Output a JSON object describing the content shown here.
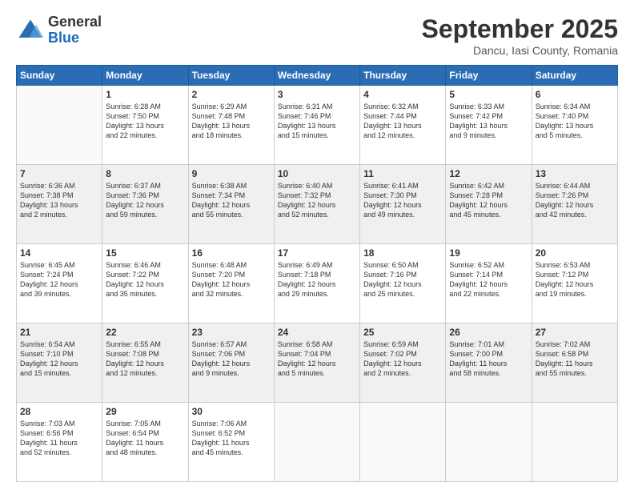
{
  "header": {
    "logo_general": "General",
    "logo_blue": "Blue",
    "month": "September 2025",
    "location": "Dancu, Iasi County, Romania"
  },
  "weekdays": [
    "Sunday",
    "Monday",
    "Tuesday",
    "Wednesday",
    "Thursday",
    "Friday",
    "Saturday"
  ],
  "weeks": [
    [
      {
        "day": "",
        "info": ""
      },
      {
        "day": "1",
        "info": "Sunrise: 6:28 AM\nSunset: 7:50 PM\nDaylight: 13 hours\nand 22 minutes."
      },
      {
        "day": "2",
        "info": "Sunrise: 6:29 AM\nSunset: 7:48 PM\nDaylight: 13 hours\nand 18 minutes."
      },
      {
        "day": "3",
        "info": "Sunrise: 6:31 AM\nSunset: 7:46 PM\nDaylight: 13 hours\nand 15 minutes."
      },
      {
        "day": "4",
        "info": "Sunrise: 6:32 AM\nSunset: 7:44 PM\nDaylight: 13 hours\nand 12 minutes."
      },
      {
        "day": "5",
        "info": "Sunrise: 6:33 AM\nSunset: 7:42 PM\nDaylight: 13 hours\nand 9 minutes."
      },
      {
        "day": "6",
        "info": "Sunrise: 6:34 AM\nSunset: 7:40 PM\nDaylight: 13 hours\nand 5 minutes."
      }
    ],
    [
      {
        "day": "7",
        "info": "Sunrise: 6:36 AM\nSunset: 7:38 PM\nDaylight: 13 hours\nand 2 minutes."
      },
      {
        "day": "8",
        "info": "Sunrise: 6:37 AM\nSunset: 7:36 PM\nDaylight: 12 hours\nand 59 minutes."
      },
      {
        "day": "9",
        "info": "Sunrise: 6:38 AM\nSunset: 7:34 PM\nDaylight: 12 hours\nand 55 minutes."
      },
      {
        "day": "10",
        "info": "Sunrise: 6:40 AM\nSunset: 7:32 PM\nDaylight: 12 hours\nand 52 minutes."
      },
      {
        "day": "11",
        "info": "Sunrise: 6:41 AM\nSunset: 7:30 PM\nDaylight: 12 hours\nand 49 minutes."
      },
      {
        "day": "12",
        "info": "Sunrise: 6:42 AM\nSunset: 7:28 PM\nDaylight: 12 hours\nand 45 minutes."
      },
      {
        "day": "13",
        "info": "Sunrise: 6:44 AM\nSunset: 7:26 PM\nDaylight: 12 hours\nand 42 minutes."
      }
    ],
    [
      {
        "day": "14",
        "info": "Sunrise: 6:45 AM\nSunset: 7:24 PM\nDaylight: 12 hours\nand 39 minutes."
      },
      {
        "day": "15",
        "info": "Sunrise: 6:46 AM\nSunset: 7:22 PM\nDaylight: 12 hours\nand 35 minutes."
      },
      {
        "day": "16",
        "info": "Sunrise: 6:48 AM\nSunset: 7:20 PM\nDaylight: 12 hours\nand 32 minutes."
      },
      {
        "day": "17",
        "info": "Sunrise: 6:49 AM\nSunset: 7:18 PM\nDaylight: 12 hours\nand 29 minutes."
      },
      {
        "day": "18",
        "info": "Sunrise: 6:50 AM\nSunset: 7:16 PM\nDaylight: 12 hours\nand 25 minutes."
      },
      {
        "day": "19",
        "info": "Sunrise: 6:52 AM\nSunset: 7:14 PM\nDaylight: 12 hours\nand 22 minutes."
      },
      {
        "day": "20",
        "info": "Sunrise: 6:53 AM\nSunset: 7:12 PM\nDaylight: 12 hours\nand 19 minutes."
      }
    ],
    [
      {
        "day": "21",
        "info": "Sunrise: 6:54 AM\nSunset: 7:10 PM\nDaylight: 12 hours\nand 15 minutes."
      },
      {
        "day": "22",
        "info": "Sunrise: 6:55 AM\nSunset: 7:08 PM\nDaylight: 12 hours\nand 12 minutes."
      },
      {
        "day": "23",
        "info": "Sunrise: 6:57 AM\nSunset: 7:06 PM\nDaylight: 12 hours\nand 9 minutes."
      },
      {
        "day": "24",
        "info": "Sunrise: 6:58 AM\nSunset: 7:04 PM\nDaylight: 12 hours\nand 5 minutes."
      },
      {
        "day": "25",
        "info": "Sunrise: 6:59 AM\nSunset: 7:02 PM\nDaylight: 12 hours\nand 2 minutes."
      },
      {
        "day": "26",
        "info": "Sunrise: 7:01 AM\nSunset: 7:00 PM\nDaylight: 11 hours\nand 58 minutes."
      },
      {
        "day": "27",
        "info": "Sunrise: 7:02 AM\nSunset: 6:58 PM\nDaylight: 11 hours\nand 55 minutes."
      }
    ],
    [
      {
        "day": "28",
        "info": "Sunrise: 7:03 AM\nSunset: 6:56 PM\nDaylight: 11 hours\nand 52 minutes."
      },
      {
        "day": "29",
        "info": "Sunrise: 7:05 AM\nSunset: 6:54 PM\nDaylight: 11 hours\nand 48 minutes."
      },
      {
        "day": "30",
        "info": "Sunrise: 7:06 AM\nSunset: 6:52 PM\nDaylight: 11 hours\nand 45 minutes."
      },
      {
        "day": "",
        "info": ""
      },
      {
        "day": "",
        "info": ""
      },
      {
        "day": "",
        "info": ""
      },
      {
        "day": "",
        "info": ""
      }
    ]
  ]
}
